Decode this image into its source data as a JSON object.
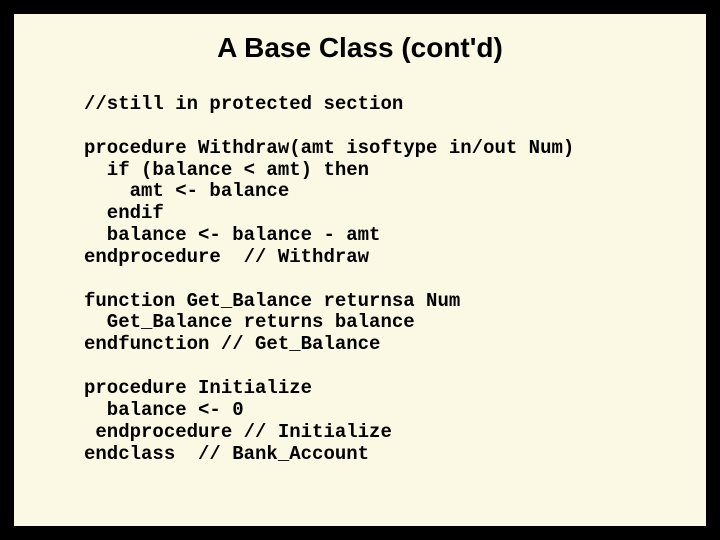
{
  "title": "A Base Class (cont'd)",
  "code": {
    "l1": "//still in protected section",
    "l2": "",
    "l3": "procedure Withdraw(amt isoftype in/out Num)",
    "l4": "  if (balance < amt) then",
    "l5": "    amt <- balance",
    "l6": "  endif",
    "l7": "  balance <- balance - amt",
    "l8": "endprocedure  // Withdraw",
    "l9": "",
    "l10": "function Get_Balance returnsa Num",
    "l11": "  Get_Balance returns balance",
    "l12": "endfunction // Get_Balance",
    "l13": "",
    "l14": "procedure Initialize",
    "l15": "  balance <- 0",
    "l16": " endprocedure // Initialize",
    "l17": "endclass  // Bank_Account"
  }
}
